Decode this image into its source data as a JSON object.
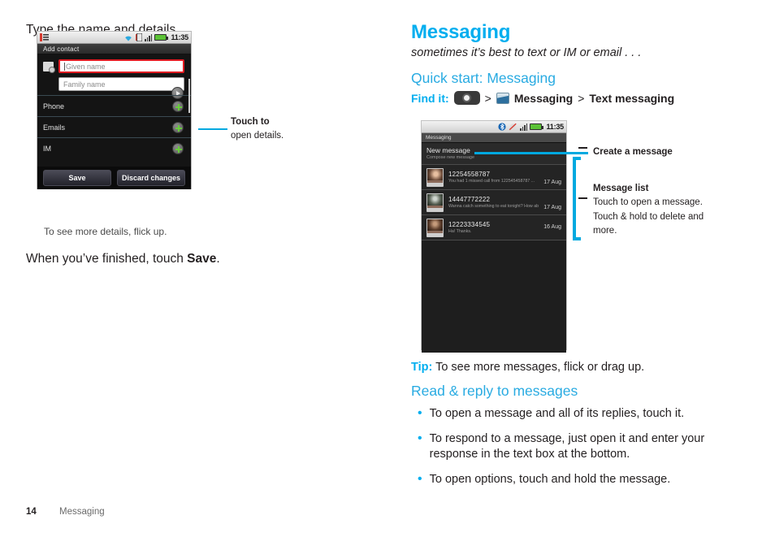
{
  "left": {
    "intro": "Type the name and details.",
    "phone_contact": {
      "statusbar": {
        "time": "11:35",
        "icons": [
          "notification-icon",
          "wifi-icon",
          "sim-icon",
          "signal-icon",
          "battery-icon"
        ]
      },
      "title": "Add contact",
      "given_name_placeholder": "Given name",
      "family_name_placeholder": "Family name",
      "rows": [
        "Phone",
        "Emails",
        "IM"
      ],
      "buttons": {
        "save": "Save",
        "discard": "Discard changes"
      }
    },
    "callout": {
      "line1": "Touch to",
      "line2": "open details."
    },
    "caption": "To see more details, flick up.",
    "closing_prefix": "When you’ve finished, touch ",
    "closing_bold": "Save",
    "closing_suffix": "."
  },
  "right": {
    "title": "Messaging",
    "subtitle": "sometimes it’s best to text or IM or email . . .",
    "quick_start": "Quick start: Messaging",
    "find_it": {
      "label": "Find it:",
      "sep1": ">",
      "app": "Messaging",
      "sep2": ">",
      "target": "Text messaging",
      "launcher_icon": "app-launcher-icon",
      "messaging_icon": "messaging-app-icon"
    },
    "phone_msg": {
      "statusbar": {
        "time": "11:35",
        "icons": [
          "bluetooth-icon",
          "mute-icon",
          "signal-icon",
          "battery-icon"
        ]
      },
      "title": "Messaging",
      "new_message": {
        "title": "New message",
        "subtitle": "Compose new message"
      },
      "messages": [
        {
          "number": "12254558787",
          "preview": "You had 1 missed call from 122545458787  ...",
          "date": "17 Aug"
        },
        {
          "number": "14447772222",
          "preview": "Wanna catch something to eat tonight? How about . . .",
          "date": "17 Aug"
        },
        {
          "number": "12223334545",
          "preview": "Ha! Thanks.",
          "date": "16 Aug"
        }
      ]
    },
    "callouts": {
      "create": "Create a message",
      "list_title": "Message list",
      "list_body_1": "Touch to open a message.",
      "list_body_2": "Touch & hold to delete and",
      "list_body_3": "more."
    },
    "tip": {
      "label": "Tip:",
      "text": " To see more messages, flick or drag up."
    },
    "read_reply_heading": "Read & reply to messages",
    "bullets": [
      "To open a message and all of its replies, touch it.",
      "To respond to a message, just open it and enter your response in the text box at the bottom.",
      "To open options, touch and hold the message."
    ]
  },
  "footer": {
    "page_number": "14",
    "section": "Messaging"
  },
  "colors": {
    "accent": "#00aeef",
    "heading": "#29abe2",
    "callout_rule": "#00a9e0",
    "body": "#231f20"
  }
}
